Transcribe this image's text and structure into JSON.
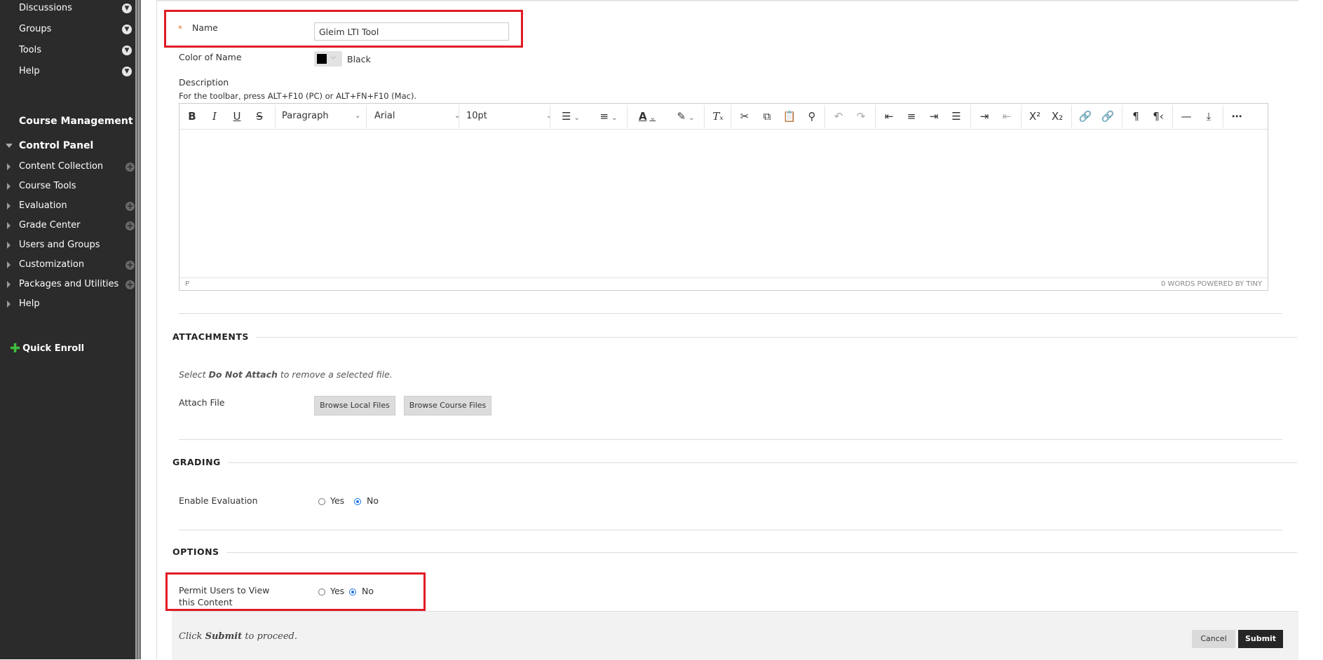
{
  "sidebar": {
    "top_items": [
      "Discussions",
      "Groups",
      "Tools",
      "Help"
    ],
    "course_management": "Course Management",
    "control_panel": "Control Panel",
    "items": [
      {
        "label": "Content Collection",
        "add": true
      },
      {
        "label": "Course Tools",
        "add": false
      },
      {
        "label": "Evaluation",
        "add": true
      },
      {
        "label": "Grade Center",
        "add": true
      },
      {
        "label": "Users and Groups",
        "add": false
      },
      {
        "label": "Customization",
        "add": true
      },
      {
        "label": "Packages and Utilities",
        "add": true
      },
      {
        "label": "Help",
        "add": false
      }
    ],
    "quick_enroll": "Quick Enroll"
  },
  "form": {
    "required_marker": "*",
    "name_label": "Name",
    "name_value": "Gleim LTI Tool",
    "color_label": "Color of Name",
    "color_value": "Black",
    "color_hex": "#000000",
    "description_label": "Description",
    "toolbar_hint": "For the toolbar, press ALT+F10 (PC) or ALT+FN+F10 (Mac)."
  },
  "editor": {
    "format_select": "Paragraph",
    "font_select": "Arial",
    "size_select": "10pt",
    "status_path": "P",
    "status_right": "0 WORDS  POWERED BY TINY"
  },
  "attachments": {
    "heading": "ATTACHMENTS",
    "hint_pre": "Select ",
    "hint_bold": "Do Not Attach",
    "hint_post": " to remove a selected file.",
    "attach_label": "Attach File",
    "browse_local": "Browse Local Files",
    "browse_course": "Browse Course Files"
  },
  "grading": {
    "heading": "GRADING",
    "enable_label": "Enable Evaluation",
    "yes": "Yes",
    "no": "No",
    "selected": "No"
  },
  "options": {
    "heading": "OPTIONS",
    "permit_label": "Permit Users to View this Content",
    "yes": "Yes",
    "no": "No",
    "selected": "No"
  },
  "footer": {
    "text_pre": "Click ",
    "text_bold": "Submit",
    "text_post": " to proceed.",
    "cancel": "Cancel",
    "submit": "Submit"
  },
  "colors": {
    "sidebar_bg": "#2b2b2b",
    "highlight_red": "#e01b24",
    "radio_blue": "#1a73e8",
    "submit_bg": "#262626"
  }
}
